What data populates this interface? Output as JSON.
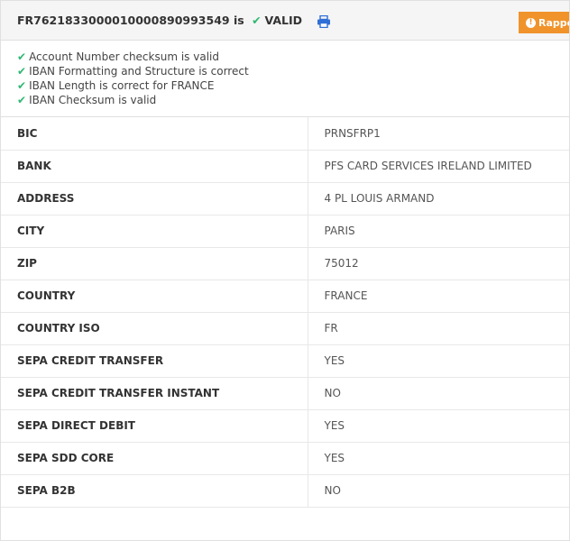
{
  "header": {
    "iban": "FR7621833000010000890993549",
    "is_text": "is",
    "check_glyph": "✔",
    "status": "VALID",
    "printer_icon": "printer-icon",
    "report_label": "Rappor",
    "report_icon": "!",
    "accent_color": "#f0932b",
    "valid_color": "#2eb872"
  },
  "checks": [
    "Account Number checksum is valid",
    "IBAN Formatting and Structure is correct",
    "IBAN Length is correct for FRANCE",
    "IBAN Checksum is valid"
  ],
  "check_glyph": "✔",
  "details": [
    {
      "key": "BIC",
      "value": "PRNSFRP1"
    },
    {
      "key": "BANK",
      "value": "PFS CARD SERVICES IRELAND LIMITED"
    },
    {
      "key": "ADDRESS",
      "value": "4 PL LOUIS ARMAND"
    },
    {
      "key": "CITY",
      "value": "PARIS"
    },
    {
      "key": "ZIP",
      "value": "75012"
    },
    {
      "key": "COUNTRY",
      "value": "FRANCE"
    },
    {
      "key": "COUNTRY ISO",
      "value": "FR"
    },
    {
      "key": "SEPA CREDIT TRANSFER",
      "value": "YES"
    },
    {
      "key": "SEPA CREDIT TRANSFER INSTANT",
      "value": "NO"
    },
    {
      "key": "SEPA DIRECT DEBIT",
      "value": "YES"
    },
    {
      "key": "SEPA SDD CORE",
      "value": "YES"
    },
    {
      "key": "SEPA B2B",
      "value": "NO"
    }
  ]
}
